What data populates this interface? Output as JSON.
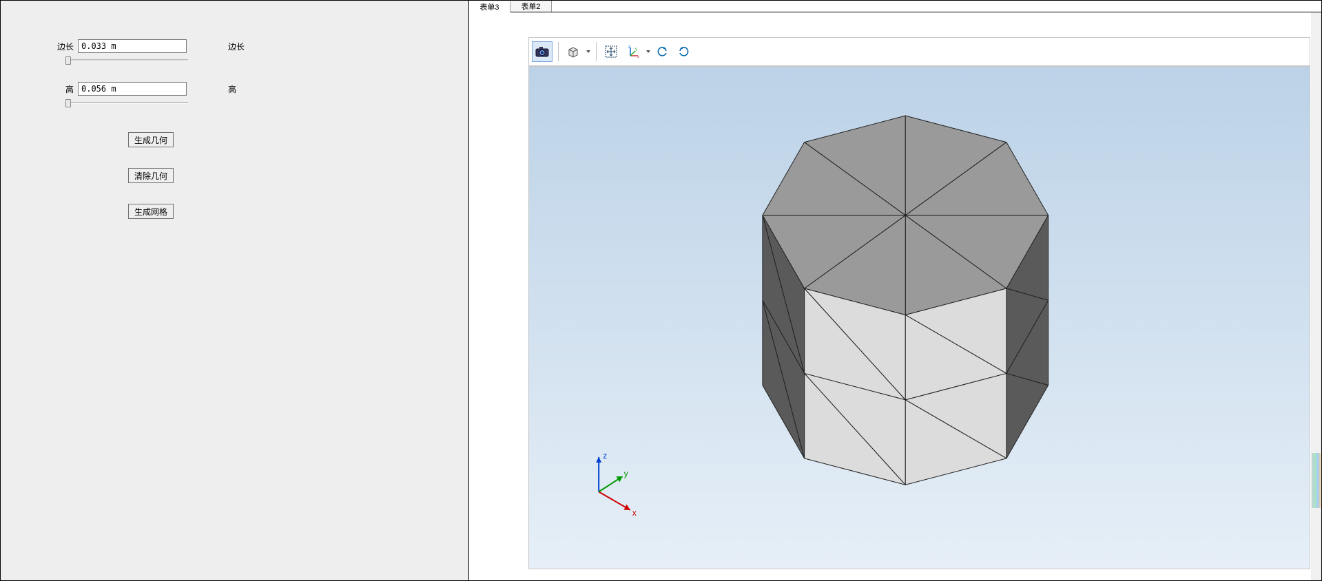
{
  "left_panel": {
    "edge_label": "边长",
    "edge_value": "0.033 m",
    "edge_label_right": "边长",
    "height_label": "高",
    "height_value": "0.056 m",
    "height_label_right": "高",
    "buttons": {
      "generate_geometry": "生成几何",
      "clear_geometry": "清除几何",
      "generate_mesh": "生成网格"
    }
  },
  "tabs": {
    "tab3": "表单3",
    "tab2": "表单2"
  },
  "toolbar_icons": {
    "camera": "camera-icon",
    "box": "box-view-icon",
    "move": "pan-icon",
    "axes": "axes-icon",
    "rotate_ccw": "rotate-ccw-icon",
    "rotate_cw": "rotate-cw-icon"
  },
  "axis_labels": {
    "x": "x",
    "y": "y",
    "z": "z"
  }
}
